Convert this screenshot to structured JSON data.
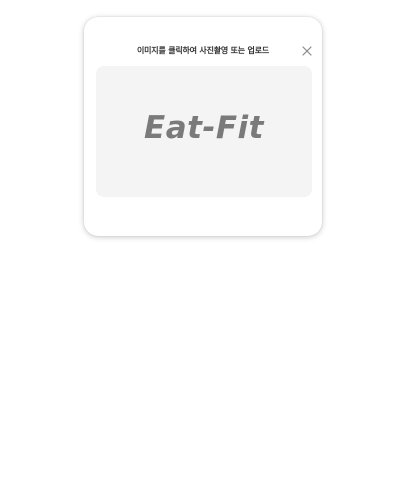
{
  "modal": {
    "title": "이미지를 클릭하여 사진촬영 또는 업로드",
    "close_icon": "close-icon",
    "upload_area": {
      "logo_text": "Eat-Fit"
    }
  },
  "colors": {
    "page_background": "#ffffff",
    "upload_area_background": "#f5f4f5",
    "logo": "#7a7a7a",
    "title": "#333333"
  }
}
